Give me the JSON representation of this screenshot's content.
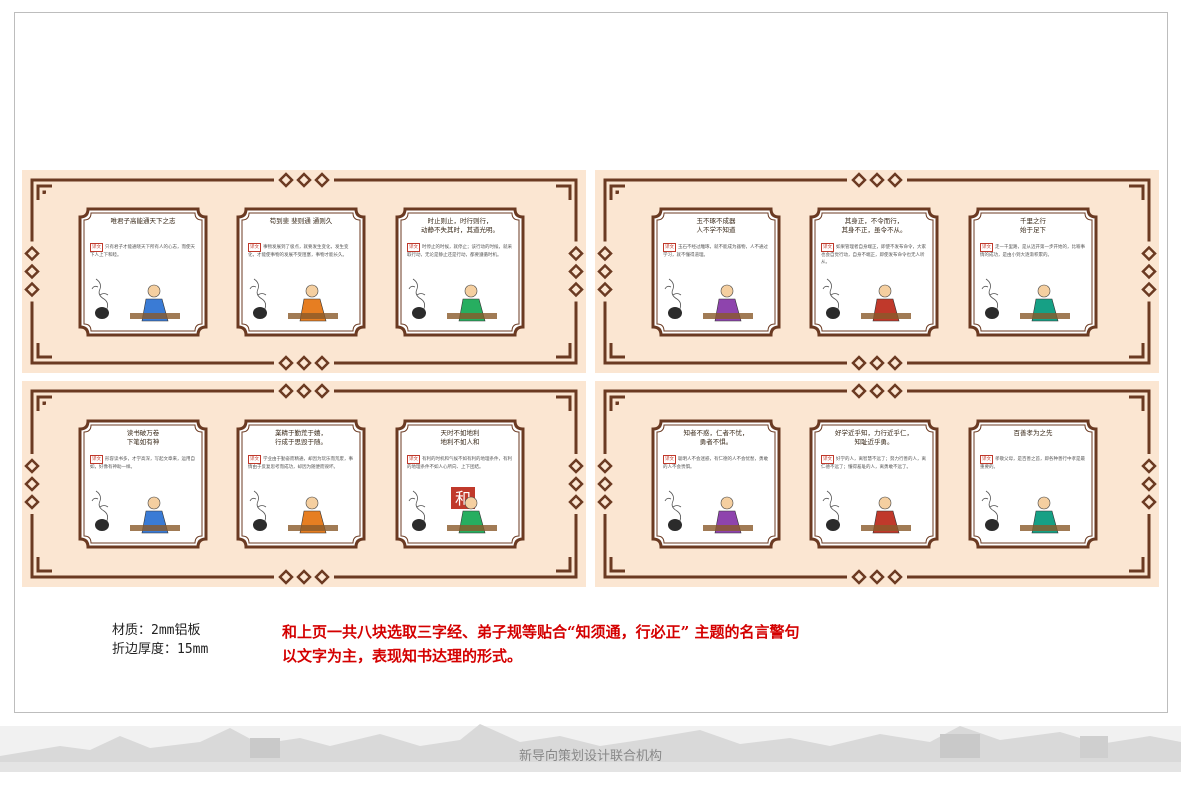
{
  "panels": [
    {
      "cards": [
        {
          "title": "唯君子高能通天下之志",
          "tag": "译文",
          "text": "只有君子才能通晓天下所有人的心志，而使天下人上下和睦。"
        },
        {
          "title": "苟到斐 斐则通 通则久",
          "tag": "译文",
          "text": "事物发展到了极点，就要发生变化，发生变化，才能使事物的发展不受阻塞，事物才能长久。"
        },
        {
          "title": "时止则止，时行则行，\n动静不失其时，其道光明。",
          "tag": "译文",
          "text": "时停止的时候，就停止；该行动的时候，就采取行动，无论是静止还是行动，都要遵循时机。"
        }
      ]
    },
    {
      "cards": [
        {
          "title": "玉不琢不成器\n人不学不知道",
          "tag": "译文",
          "text": "玉石不经过雕琢，就不能成为器物，人不通过学习，就不懂得道理。"
        },
        {
          "title": "其身正，不令而行，\n其身不正，虽令不从。",
          "tag": "译文",
          "text": "如果管理者自身端正，即使不发布命令，大家也会自觉行动，自身不端正，即使发布命令也无人听从。"
        },
        {
          "title": "千里之行\n始于足下",
          "tag": "译文",
          "text": "走一千里路，是从迈开第一步开始的，比喻事情的成功，是由小到大逐渐积累的。"
        }
      ]
    },
    {
      "cards": [
        {
          "title": "读书破万卷\n下笔如有神",
          "tag": "译文",
          "text": "形容读书多，才学高深，写起文章来，运用自如，好像有神助一样。"
        },
        {
          "title": "業精于勤荒于嬉，\n行成于思毁于随。",
          "tag": "译文",
          "text": "学业由于勤奋而精通，却因为玩乐而荒废，事情由于反复思考而成功，却因为随便而毁坏。"
        },
        {
          "title": "天时不如地利\n地利不如人和",
          "tag": "译文",
          "text": "有利的时机和气候不如有利的地理条件，有利的地理条件不如人心所向、上下团结。"
        }
      ]
    },
    {
      "cards": [
        {
          "title": "知者不惑，仁者不忧，\n勇者不惧。",
          "tag": "译文",
          "text": "聪明人不会迷惑，有仁德的人不会忧愁，勇敢的人不会畏惧。"
        },
        {
          "title": "好学近乎知，力行近乎仁，\n知耻近乎勇。",
          "tag": "译文",
          "text": "好学的人，离智慧不远了；努力行善的人，离仁德不远了；懂得羞耻的人，离勇敢不远了。"
        },
        {
          "title": "百善孝为之先",
          "tag": "译文",
          "text": "孝敬父母，是百善之首，即各种善行中孝是最重要的。"
        }
      ]
    }
  ],
  "footnote": {
    "material": "材质：2mm铝板",
    "fold": "折边厚度：15mm"
  },
  "caption": {
    "line1": "和上页一共八块选取三字经、弟子规等贴合“知须通，行必正” 主题的名言警句",
    "line2": "以文字为主，表现知书达理的形式。"
  },
  "character": "和",
  "organization": "新导向策划设计联合机构",
  "colors": {
    "panel": "#fbe6d2",
    "border": "#6b3a22",
    "caption": "#d40000"
  }
}
